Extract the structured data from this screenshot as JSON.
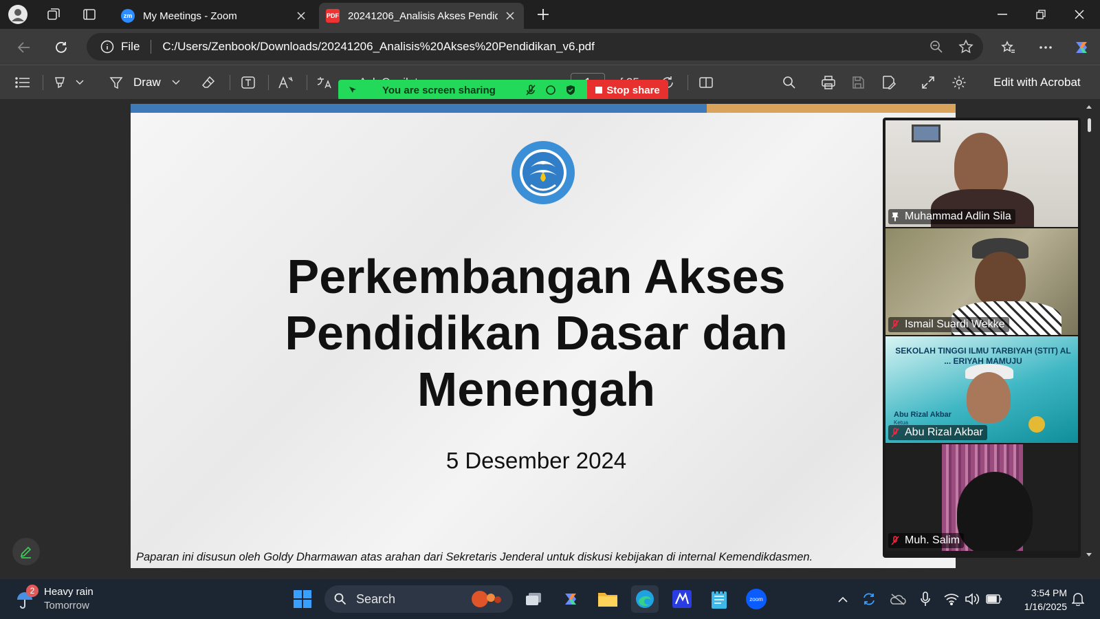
{
  "browser": {
    "tabs": [
      {
        "label": "My Meetings - Zoom",
        "favicon": "zm"
      },
      {
        "label": "20241206_Analisis Akses Pendidik",
        "favicon": "PDF"
      }
    ],
    "address": {
      "scheme_label": "File",
      "url": "C:/Users/Zenbook/Downloads/20241206_Analisis%20Akses%20Pendidikan_v6.pdf"
    }
  },
  "pdf_toolbar": {
    "draw_label": "Draw",
    "copilot_label": "Ask Copilot",
    "page_current": "1",
    "page_total": "of 25",
    "edit_label": "Edit with Acrobat"
  },
  "share_banner": {
    "status": "You are screen sharing",
    "stop_label": "Stop share",
    "colors": {
      "green": "#23d959",
      "red": "#e8302f"
    }
  },
  "slide": {
    "title": "Perkembangan Akses Pendidikan Dasar dan Menengah",
    "date": "5 Desember 2024",
    "footer": "Paparan ini disusun oleh Goldy Dharmawan atas arahan dari Sekretaris Jenderal untuk diskusi kebijakan di internal Kemendikdasmen.",
    "logo_text": "TUT WURI HANDAYANI",
    "accent_colors": {
      "blue": "#3f79b8",
      "orange": "#d9a35c"
    }
  },
  "participants": [
    {
      "name": "Muhammad Adlin Sila",
      "icon": "pin-icon",
      "speaking": true
    },
    {
      "name": "Ismail Suardi Wekke",
      "icon": "mic-muted-icon"
    },
    {
      "name": "Abu Rizal Akbar",
      "icon": "mic-muted-icon",
      "background_text": "SEKOLAH TINGGI ILMU TARBIYAH (STIT) AL ... ERIYAH MAMUJU",
      "overlay_name": "Abu Rizal Akbar",
      "overlay_role": "Ketua"
    },
    {
      "name": "Muh. Salim",
      "icon": "mic-muted-icon"
    }
  ],
  "taskbar": {
    "weather": {
      "title": "Heavy rain",
      "subtitle": "Tomorrow",
      "badge": "2"
    },
    "search_placeholder": "Search",
    "time": "3:54 PM",
    "date": "1/16/2025"
  }
}
